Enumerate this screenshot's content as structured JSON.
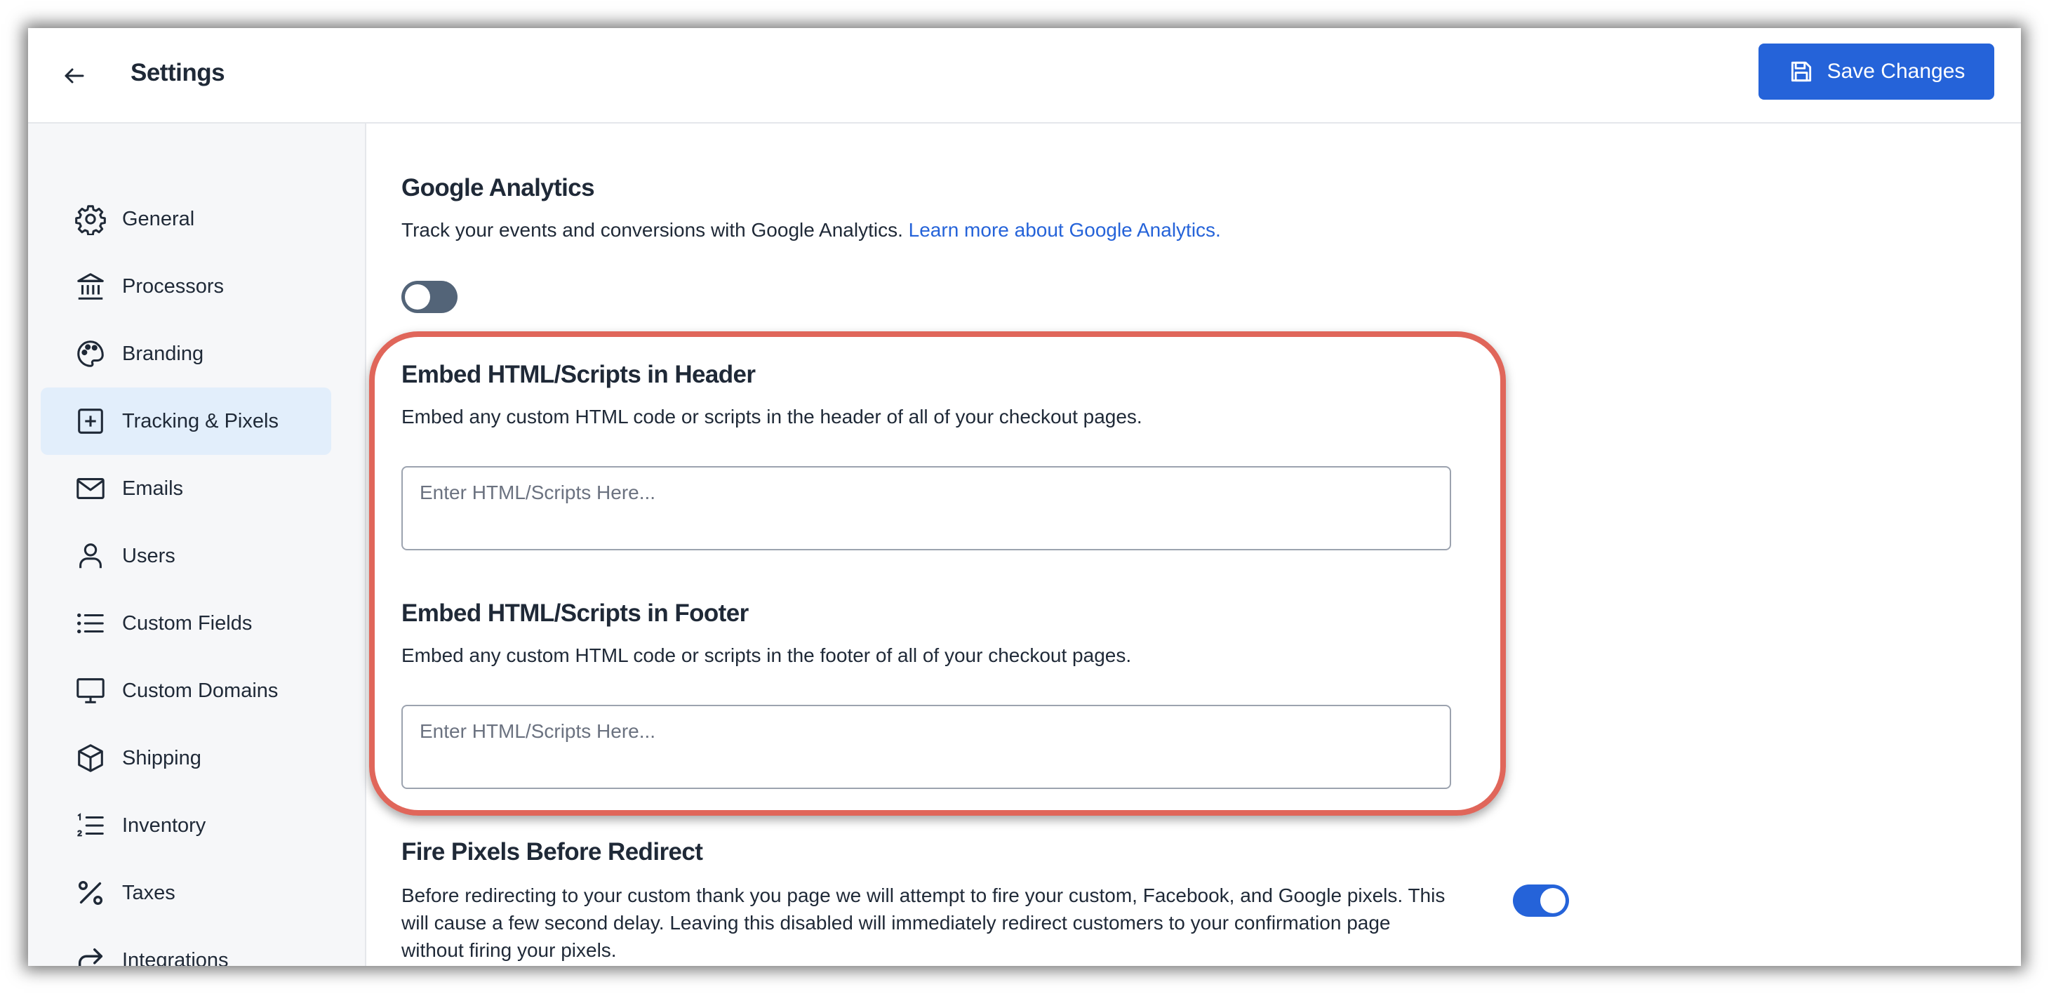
{
  "header": {
    "title": "Settings",
    "save_label": "Save Changes"
  },
  "sidebar": {
    "items": [
      {
        "label": "General",
        "icon": "gear-icon"
      },
      {
        "label": "Processors",
        "icon": "bank-icon"
      },
      {
        "label": "Branding",
        "icon": "palette-icon"
      },
      {
        "label": "Tracking & Pixels",
        "icon": "plus-square-icon",
        "active": true
      },
      {
        "label": "Emails",
        "icon": "envelope-icon"
      },
      {
        "label": "Users",
        "icon": "user-icon"
      },
      {
        "label": "Custom Fields",
        "icon": "list-icon"
      },
      {
        "label": "Custom Domains",
        "icon": "monitor-icon"
      },
      {
        "label": "Shipping",
        "icon": "box-icon"
      },
      {
        "label": "Inventory",
        "icon": "numbered-list-icon"
      },
      {
        "label": "Taxes",
        "icon": "percent-icon"
      },
      {
        "label": "Integrations",
        "icon": "arrow-turn-icon"
      }
    ]
  },
  "google_analytics": {
    "title": "Google Analytics",
    "description": "Track your events and conversions with Google Analytics.",
    "link_text": "Learn more about Google Analytics.",
    "enabled": false
  },
  "header_scripts": {
    "title": "Embed HTML/Scripts in Header",
    "description": "Embed any custom HTML code or scripts in the header of all of your checkout pages.",
    "placeholder": "Enter HTML/Scripts Here..."
  },
  "footer_scripts": {
    "title": "Embed HTML/Scripts in Footer",
    "description": "Embed any custom HTML code or scripts in the footer of all of your checkout pages.",
    "placeholder": "Enter HTML/Scripts Here..."
  },
  "fire_pixels": {
    "title": "Fire Pixels Before Redirect",
    "description": "Before redirecting to your custom thank you page we will attempt to fire your custom, Facebook, and Google pixels. This will cause a few second delay. Leaving this disabled will immediately redirect customers to your confirmation page without firing your pixels.",
    "enabled": true
  },
  "colors": {
    "accent": "#2563d9",
    "highlight": "#e0665a",
    "toggle_off": "#536478",
    "active_nav_bg": "#e2eefb"
  }
}
